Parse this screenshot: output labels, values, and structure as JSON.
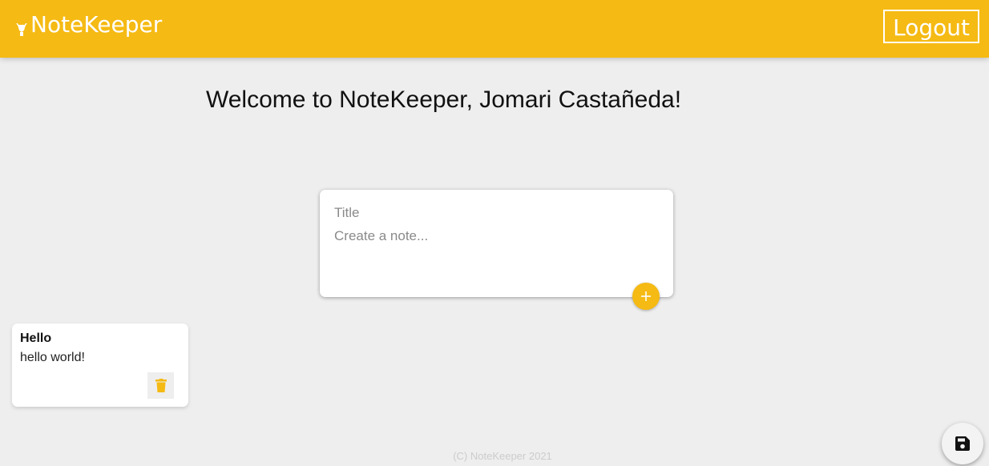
{
  "header": {
    "brand_name": "NoteKeeper",
    "brand_icon": "lightbulb-icon",
    "logout_label": "Logout",
    "background_color": "#f5ba13"
  },
  "main": {
    "welcome_text": "Welcome to NoteKeeper, Jomari Castañeda!"
  },
  "create_note": {
    "title_placeholder": "Title",
    "content_placeholder": "Create a note...",
    "add_icon": "plus-icon"
  },
  "notes": [
    {
      "title": "Hello",
      "content": "hello world!",
      "delete_icon": "trash-icon"
    }
  ],
  "footer": {
    "text": "(C) NoteKeeper 2021"
  },
  "save_button": {
    "icon": "save-icon"
  },
  "colors": {
    "accent": "#f5ba13",
    "page_background": "#eeeeee",
    "card_background": "#ffffff"
  }
}
